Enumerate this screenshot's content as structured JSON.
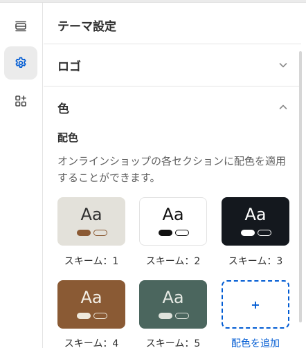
{
  "rail": {
    "items": [
      {
        "icon": "sections-icon",
        "active": false
      },
      {
        "icon": "gear-icon",
        "active": true
      },
      {
        "icon": "apps-add-icon",
        "active": false
      }
    ]
  },
  "panel": {
    "title": "テーマ設定",
    "sections": [
      {
        "label": "ロゴ",
        "expanded": false
      },
      {
        "label": "色",
        "expanded": true
      }
    ]
  },
  "colors": {
    "subheading": "配色",
    "description": "オンラインショップの各セクションに配色を適用することができます。",
    "schemes": [
      {
        "label": "スキーム：1",
        "sample": "Aa",
        "background": "#e3e1da",
        "text": "#303030",
        "pill1": "#8b5a34",
        "pill2_border": "#8b5a34",
        "border": "#e3e1da"
      },
      {
        "label": "スキーム：2",
        "sample": "Aa",
        "background": "#ffffff",
        "text": "#121212",
        "pill1": "#121212",
        "pill2_border": "#121212",
        "border": "#e3e3e3"
      },
      {
        "label": "スキーム：3",
        "sample": "Aa",
        "background": "#14181e",
        "text": "#ffffff",
        "pill1": "#ffffff",
        "pill2_border": "#ffffff",
        "border": "#14181e"
      },
      {
        "label": "スキーム：4",
        "sample": "Aa",
        "background": "#8a5a34",
        "text": "#f3efe6",
        "pill1": "#efe9dc",
        "pill2_border": "#efe9dc",
        "border": "#8a5a34"
      },
      {
        "label": "スキーム：5",
        "sample": "Aa",
        "background": "#4b665e",
        "text": "#e6eae4",
        "pill1": "#dfe3dc",
        "pill2_border": "#dfe3dc",
        "border": "#4b665e"
      }
    ],
    "add": {
      "label": "配色を追加",
      "symbol": "+"
    }
  },
  "accent": "#005bd3"
}
